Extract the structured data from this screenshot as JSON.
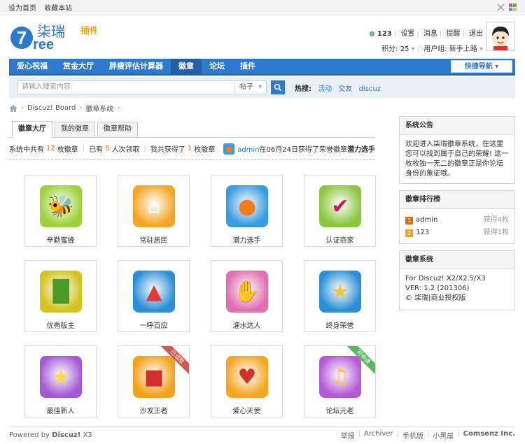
{
  "topbar": {
    "set_home": "设为首页",
    "bookmark": "收藏本站"
  },
  "logo": {
    "brand_digit": "7",
    "brand_latin": "ree",
    "brand_cn": "柒瑞",
    "brand_sub": "插件"
  },
  "user": {
    "name": "123",
    "settings": "设置",
    "messages": "消息",
    "reminders": "提醒",
    "logout": "退出",
    "points": "积分: 25",
    "group": "用户组: 新手上路"
  },
  "nav": {
    "items": [
      "爱心祝福",
      "赏金大厅",
      "胖瘦评估计算器",
      "徽章",
      "论坛",
      "插件"
    ],
    "active_index": 3,
    "quick_nav": "快捷导航"
  },
  "search": {
    "placeholder": "请输入搜索内容",
    "type": "帖子",
    "hot_label": "热搜:",
    "hot": [
      "活动",
      "交友",
      "discuz"
    ]
  },
  "breadcrumb": {
    "board": "Discuz! Board",
    "current": "徽章系统"
  },
  "tabs": [
    "徽章大厅",
    "我的徽章",
    "徽章帮助"
  ],
  "stats": {
    "p1": "系统中共有",
    "total": "12",
    "p2": "枚徽章",
    "p3": "已有",
    "claimed": "5",
    "p4": "人次领取",
    "p5": "我共获得了",
    "mine": "1",
    "p6": "枚徽章"
  },
  "news": {
    "user": "admin",
    "text": "在06月24日获得了荣誉徽章",
    "badge": "潜力选手"
  },
  "badges": [
    {
      "name": "辛勤蜜蜂",
      "icon": "bee-icon",
      "color": "#9ed23a",
      "ribbon": ""
    },
    {
      "name": "常驻居民",
      "icon": "house-icon",
      "color": "#f5a623",
      "ribbon": ""
    },
    {
      "name": "潜力选手",
      "icon": "fruit-icon",
      "color": "#3a9be0",
      "ribbon": ""
    },
    {
      "name": "认证商家",
      "icon": "check-icon",
      "color": "#8cc63f",
      "ribbon": ""
    },
    {
      "name": "优秀版主",
      "icon": "bamboo-icon",
      "color": "#d4c21e",
      "ribbon": ""
    },
    {
      "name": "一呼百应",
      "icon": "torch-icon",
      "color": "#2a8fd8",
      "ribbon": ""
    },
    {
      "name": "灌水达人",
      "icon": "hand-icon",
      "color": "#e06fb0",
      "ribbon": ""
    },
    {
      "name": "终身荣誉",
      "icon": "trophy-icon",
      "color": "#2a8fd8",
      "ribbon": ""
    },
    {
      "name": "最佳新人",
      "icon": "star-icon",
      "color": "#a25ad6",
      "ribbon": ""
    },
    {
      "name": "沙发王者",
      "icon": "sofa-icon",
      "color": "#f2a21a",
      "ribbon": "已领取"
    },
    {
      "name": "爱心天使",
      "icon": "heart-icon",
      "color": "#f5a623",
      "ribbon": ""
    },
    {
      "name": "论坛元老",
      "icon": "trumpet-icon",
      "color": "#b45ad6",
      "ribbon": "可申请"
    }
  ],
  "sidebar": {
    "notice_title": "系统公告",
    "notice_body": "欢迎进入柒瑞徽章系统，在这里您可以找到属于自己的荣耀! 这一枚枚独一无二的徽章正是你论坛身份的象征哦。",
    "rank_title": "徽章排行榜",
    "rank": [
      {
        "pos": "1",
        "user": "admin",
        "count": "获得4枚",
        "color": "#e36c0a"
      },
      {
        "pos": "2",
        "user": "123",
        "count": "获得1枚",
        "color": "#f0a22e"
      }
    ],
    "sys_title": "徽章系统",
    "sys_lines": [
      "For Discuz! X2/X2.5/X3",
      "VER: 1.2 (201306)",
      "© 柒瑞|商业授权版"
    ]
  },
  "footer": {
    "powered": "Powered by",
    "product": "Discuz!",
    "version": "X3",
    "links": [
      "举报",
      "Archiver",
      "手机版",
      "小黑屋"
    ],
    "company": "Comsenz Inc."
  }
}
